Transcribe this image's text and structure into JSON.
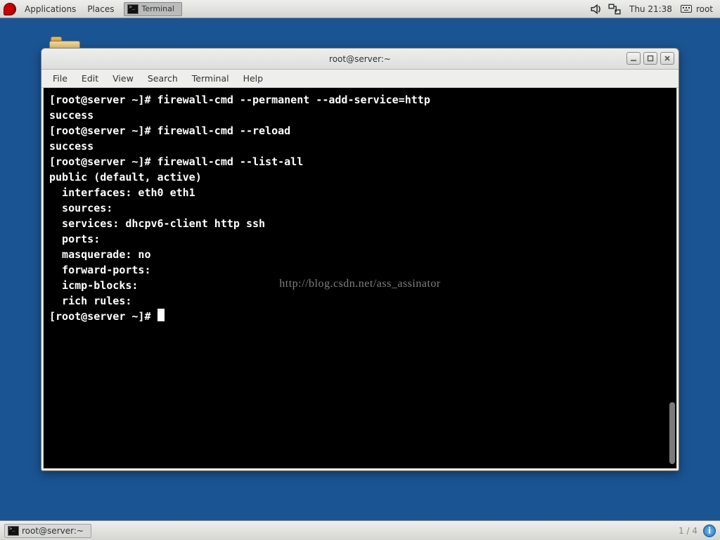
{
  "panel": {
    "applications": "Applications",
    "places": "Places",
    "taskbar_terminal": "Terminal",
    "clock": "Thu 21:38",
    "user": "root"
  },
  "window": {
    "title": "root@server:~",
    "menubar": [
      "File",
      "Edit",
      "View",
      "Search",
      "Terminal",
      "Help"
    ]
  },
  "terminal": {
    "lines": [
      "[root@server ~]# firewall-cmd --permanent --add-service=http",
      "success",
      "[root@server ~]# firewall-cmd --reload",
      "success",
      "[root@server ~]# firewall-cmd --list-all",
      "public (default, active)",
      "  interfaces: eth0 eth1",
      "  sources: ",
      "  services: dhcpv6-client http ssh",
      "  ports: ",
      "  masquerade: no",
      "  forward-ports: ",
      "  icmp-blocks: ",
      "  rich rules: ",
      "",
      "[root@server ~]# "
    ],
    "watermark": "http://blog.csdn.net/ass_assinator"
  },
  "bottom": {
    "task": "root@server:~",
    "pager": "1 / 4"
  }
}
